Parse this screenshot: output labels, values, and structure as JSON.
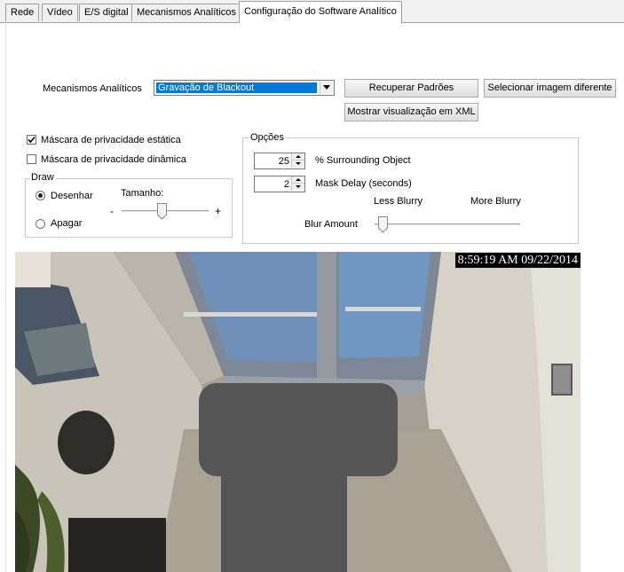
{
  "tabs": [
    {
      "label": "Rede"
    },
    {
      "label": "Vídeo"
    },
    {
      "label": "E/S digital"
    },
    {
      "label": "Mecanismos Analíticos"
    },
    {
      "label": "Configuração do Software Analítico",
      "active": true
    }
  ],
  "engine": {
    "label": "Mecanismos Analíticos",
    "selected": "Gravação de Blackout"
  },
  "buttons": {
    "restore_defaults": "Recuperar Padrões",
    "select_image": "Selecionar imagem diferente",
    "show_xml": "Mostrar visualização em XML"
  },
  "privacy": {
    "static_label": "Máscara de privacidade estática",
    "static_checked": true,
    "dynamic_label": "Máscara de privacidade dinâmica",
    "dynamic_checked": false
  },
  "draw": {
    "title": "Draw",
    "draw_label": "Desenhar",
    "erase_label": "Apagar",
    "size_label": "Tamanho:",
    "minus": "-",
    "plus": "+",
    "selected": "draw",
    "size_level_fraction": 0.45
  },
  "options": {
    "title": "Opções",
    "surrounding_value": "25",
    "surrounding_label": "% Surrounding Object",
    "mask_delay_value": "2",
    "mask_delay_label": "Mask Delay (seconds)",
    "less_blurry": "Less Blurry",
    "more_blurry": "More Blurry",
    "blur_label": "Blur Amount",
    "blur_level_fraction": 0.0
  },
  "video": {
    "timestamp": "8:59:19 AM 09/22/2014"
  },
  "colors": {
    "selection": "#0078d7",
    "mask": "#555555"
  }
}
